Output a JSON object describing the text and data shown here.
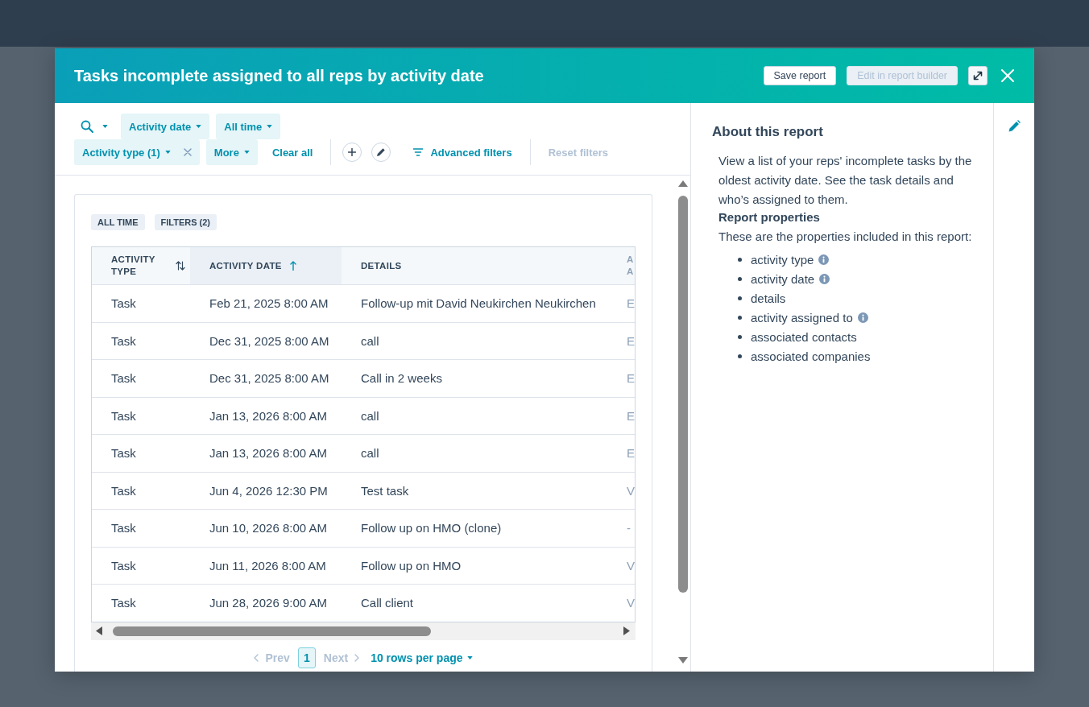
{
  "dialog": {
    "title": "Tasks incomplete assigned to all reps by activity date",
    "actions": [
      {
        "label": "Save report",
        "disabled": false
      },
      {
        "label": "Edit in report builder",
        "disabled": true
      }
    ]
  },
  "filter_bar": {
    "date_filters": [
      {
        "label": "Activity date",
        "removable": false
      },
      {
        "label": "All time",
        "removable": false
      }
    ],
    "property_filters": [
      {
        "label": "Activity type (1)",
        "removable": true
      },
      {
        "label": "More",
        "removable": false
      }
    ],
    "clear_all": "Clear all",
    "advanced_filters": "Advanced filters",
    "reset_filters": {
      "label": "Reset filters",
      "disabled": true
    }
  },
  "report": {
    "tags": [
      "ALL TIME",
      "FILTERS (2)"
    ],
    "table": {
      "columns": [
        {
          "label": "ACTIVITY TYPE",
          "sortable": true,
          "selected": false
        },
        {
          "label": "ACTIVITY DATE",
          "sortable": true,
          "selected": true
        },
        {
          "label": "DETAILS",
          "sortable": false,
          "selected": false
        },
        {
          "label": "A A",
          "sortable": false,
          "selected": false
        }
      ],
      "rows": [
        {
          "cells": [
            "Task",
            "Feb 21, 2025 8:00 AM",
            "Follow-up mit David Neukirchen Neukirchen",
            "E"
          ]
        },
        {
          "cells": [
            "Task",
            "Dec 31, 2025 8:00 AM",
            "call",
            "E"
          ]
        },
        {
          "cells": [
            "Task",
            "Dec 31, 2025 8:00 AM",
            "Call in 2 weeks",
            "E"
          ]
        },
        {
          "cells": [
            "Task",
            "Jan 13, 2026 8:00 AM",
            "call",
            "E"
          ]
        },
        {
          "cells": [
            "Task",
            "Jan 13, 2026 8:00 AM",
            "call",
            "E"
          ]
        },
        {
          "cells": [
            "Task",
            "Jun 4, 2026 12:30 PM",
            "Test task",
            "V"
          ]
        },
        {
          "cells": [
            "Task",
            "Jun 10, 2026 8:00 AM",
            "Follow up on HMO (clone)",
            "-"
          ]
        },
        {
          "cells": [
            "Task",
            "Jun 11, 2026 8:00 AM",
            "Follow up on HMO",
            "V"
          ]
        },
        {
          "cells": [
            "Task",
            "Jun 28, 2026 9:00 AM",
            "Call client",
            "V"
          ]
        }
      ]
    },
    "pagination": {
      "prev": {
        "label": "Prev",
        "disabled": true
      },
      "pages": [
        {
          "label": "1",
          "selected": true
        }
      ],
      "next": {
        "label": "Next",
        "disabled": true
      },
      "page_size": "10 rows per page"
    }
  },
  "about": {
    "title": "About this report",
    "description": "View a list of your reps' incomplete tasks by the oldest activity date. See the task details and who’s assigned to them.",
    "properties_heading": "Report properties",
    "properties_intro": "These are the properties included in this report:",
    "properties": [
      {
        "label": "activity type",
        "info": true
      },
      {
        "label": "activity date",
        "info": true
      },
      {
        "label": "details",
        "info": false
      },
      {
        "label": "activity assigned to",
        "info": true
      },
      {
        "label": "associated contacts",
        "info": false
      },
      {
        "label": "associated companies",
        "info": false
      }
    ]
  }
}
